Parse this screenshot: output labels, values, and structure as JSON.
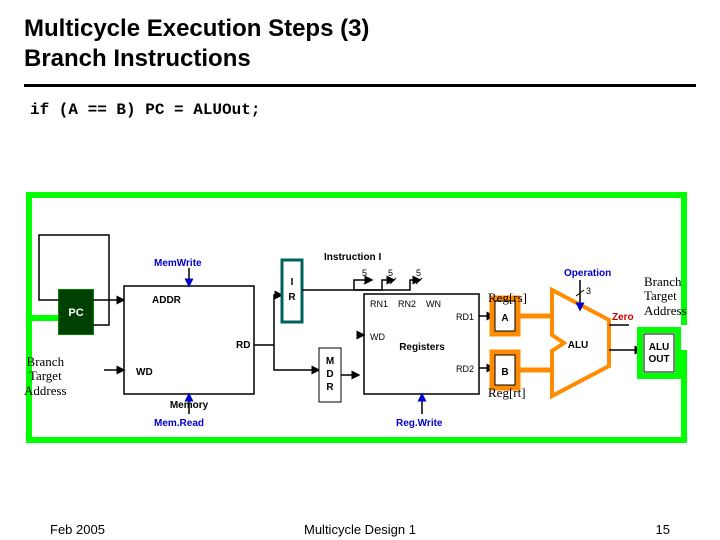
{
  "title_line1": "Multicycle Execution Steps (3)",
  "title_line2": "Branch Instructions",
  "code_line": "if (A == B) PC = ALUOut;",
  "labels": {
    "reg_rs": "Reg[rs]",
    "reg_rt": "Reg[rt]",
    "bta": "Branch\nTarget\nAddress"
  },
  "blocks": {
    "pc": "PC",
    "ir": "I\nR",
    "mdr": "M\nD\nR",
    "instruction_i": "Instruction I",
    "memory": "Memory",
    "registers": "Registers",
    "addr": "ADDR",
    "wd": "WD",
    "rd": "RD",
    "mem_write": "MemWrite",
    "mem_read": "Mem.Read",
    "reg_write": "Reg.Write",
    "rn1": "RN1",
    "rn2": "RN2",
    "wn": "WN",
    "rd1": "RD1",
    "rd2": "RD2",
    "a": "A",
    "b": "B",
    "alu": "ALU",
    "operation": "Operation",
    "zero": "Zero",
    "alu_out": "ALU\nOUT",
    "bus5": "5",
    "bus3": "3"
  },
  "footer": {
    "left": "Feb 2005",
    "mid": "Multicycle Design 1",
    "right": "15"
  }
}
